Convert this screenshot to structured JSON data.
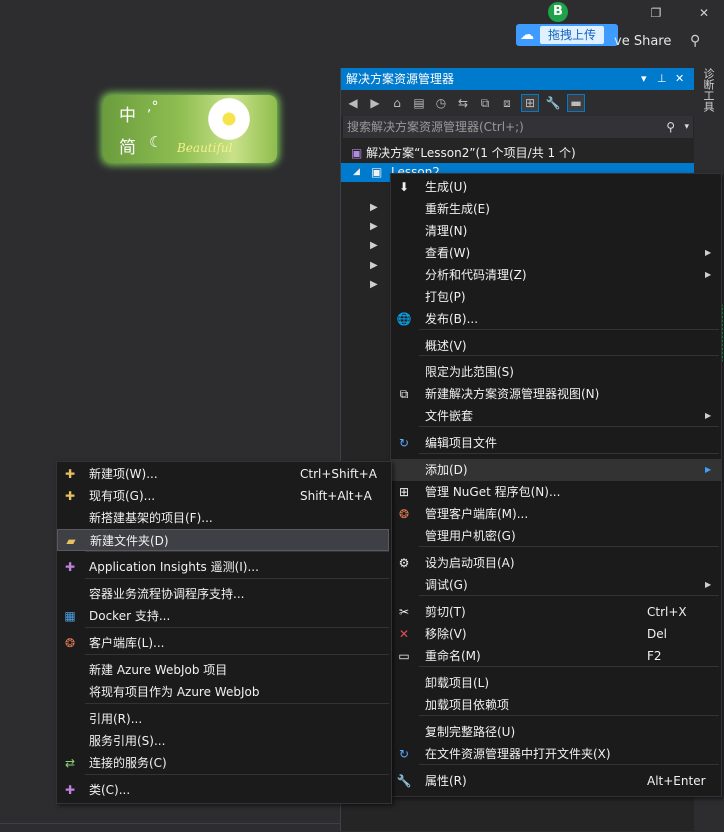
{
  "window": {
    "account_badge": "B",
    "upload_label": "拖拽上传",
    "live_share_label": "ve Share",
    "controls": {
      "restore": "❐",
      "close": "✕"
    }
  },
  "ime": {
    "top_char": "中",
    "punct": ",°",
    "mode_char": "简",
    "moon": "☾",
    "tagline": "Beautiful"
  },
  "solution_explorer": {
    "title": "解决方案资源管理器",
    "search_placeholder": "搜索解决方案资源管理器(Ctrl+;)",
    "solution_label": "解决方案“Lesson2”(1 个项目/共 1 个)",
    "project_label": "Lesson2"
  },
  "side_panel_label": "诊断工具",
  "context_menu": {
    "items": [
      {
        "label": "生成(U)",
        "icon": "build-icon"
      },
      {
        "label": "重新生成(E)"
      },
      {
        "label": "清理(N)"
      },
      {
        "label": "查看(W)",
        "submenu": true
      },
      {
        "label": "分析和代码清理(Z)",
        "submenu": true
      },
      {
        "label": "打包(P)"
      },
      {
        "label": "发布(B)...",
        "icon": "globe-icon"
      },
      {
        "label": "概述(V)"
      },
      {
        "label": "限定为此范围(S)"
      },
      {
        "label": "新建解决方案资源管理器视图(N)",
        "icon": "new-view-icon"
      },
      {
        "label": "文件嵌套",
        "submenu": true
      },
      {
        "label": "编辑项目文件",
        "icon": "refresh-arrow-icon"
      },
      {
        "label": "添加(D)",
        "submenu": true
      },
      {
        "label": "管理 NuGet 程序包(N)...",
        "icon": "nuget-icon"
      },
      {
        "label": "管理客户端库(M)...",
        "icon": "library-icon"
      },
      {
        "label": "管理用户机密(G)"
      },
      {
        "label": "设为启动项目(A)",
        "icon": "gear-icon"
      },
      {
        "label": "调试(G)",
        "submenu": true
      },
      {
        "label": "剪切(T)",
        "shortcut": "Ctrl+X",
        "icon": "scissors-icon"
      },
      {
        "label": "移除(V)",
        "shortcut": "Del",
        "icon": "remove-x-icon"
      },
      {
        "label": "重命名(M)",
        "shortcut": "F2",
        "icon": "rename-icon"
      },
      {
        "label": "卸载项目(L)"
      },
      {
        "label": "加载项目依赖项"
      },
      {
        "label": "复制完整路径(U)"
      },
      {
        "label": "在文件资源管理器中打开文件夹(X)",
        "icon": "refresh-arrow-icon"
      },
      {
        "label": "属性(R)",
        "shortcut": "Alt+Enter",
        "icon": "wrench-icon"
      }
    ]
  },
  "add_submenu": {
    "items": [
      {
        "label": "新建项(W)...",
        "shortcut": "Ctrl+Shift+A"
      },
      {
        "label": "现有项(G)...",
        "shortcut": "Shift+Alt+A"
      },
      {
        "label": "新搭建基架的项目(F)..."
      },
      {
        "label": "新建文件夹(D)"
      },
      {
        "label": "Application Insights 遥测(I)..."
      },
      {
        "label": "容器业务流程协调程序支持..."
      },
      {
        "label": "Docker 支持..."
      },
      {
        "label": "客户端库(L)..."
      },
      {
        "label": "新建 Azure WebJob 项目"
      },
      {
        "label": "将现有项目作为 Azure WebJob"
      },
      {
        "label": "引用(R)..."
      },
      {
        "label": "服务引用(S)..."
      },
      {
        "label": "连接的服务(C)"
      },
      {
        "label": "类(C)..."
      }
    ]
  }
}
